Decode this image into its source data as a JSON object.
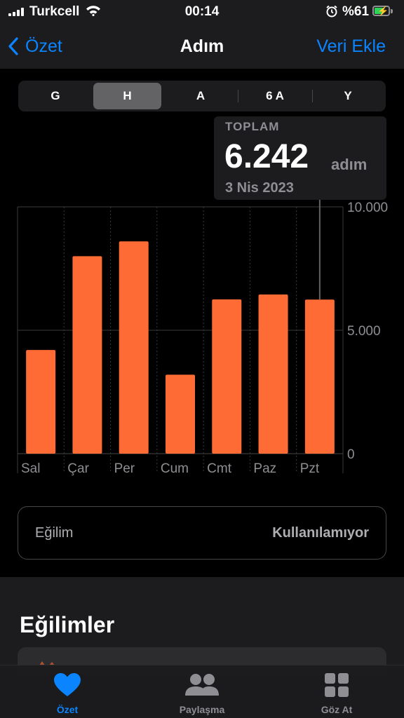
{
  "status_bar": {
    "carrier": "Turkcell",
    "time": "00:14",
    "battery_percent": "%61",
    "battery_level": 0.61,
    "battery_color": "#30d158",
    "icons": [
      "signal-icon",
      "wifi-icon",
      "alarm-icon",
      "battery-icon"
    ]
  },
  "nav": {
    "back_label": "Özet",
    "title": "Adım",
    "add_label": "Veri Ekle"
  },
  "range_selector": {
    "options": [
      "G",
      "H",
      "A",
      "6 A",
      "Y"
    ],
    "selected": "H"
  },
  "callout": {
    "label": "TOPLAM",
    "value": "6.242",
    "unit": "adım",
    "date": "3 Nis 2023"
  },
  "chart_data": {
    "type": "bar",
    "categories": [
      "Sal",
      "Çar",
      "Per",
      "Cum",
      "Cmt",
      "Paz",
      "Pzt"
    ],
    "values": [
      4200,
      8000,
      8600,
      3200,
      6250,
      6450,
      6242
    ],
    "y_ticks": [
      "10.000",
      "5.000",
      "0"
    ],
    "ylim": [
      0,
      10000
    ],
    "bar_color": "#ff6b35",
    "selected_category": "Pzt",
    "grid": true
  },
  "trend": {
    "label": "Eğilim",
    "value": "Kullanılamıyor"
  },
  "section": {
    "title": "Eğilimler"
  },
  "tabs": [
    {
      "label": "Özet",
      "icon": "heart-icon",
      "active": true
    },
    {
      "label": "Paylaşma",
      "icon": "people-icon",
      "active": false
    },
    {
      "label": "Göz At",
      "icon": "grid-icon",
      "active": false
    }
  ],
  "colors": {
    "accent": "#0a84ff",
    "background": "#000000",
    "surface": "#1c1c1e"
  }
}
